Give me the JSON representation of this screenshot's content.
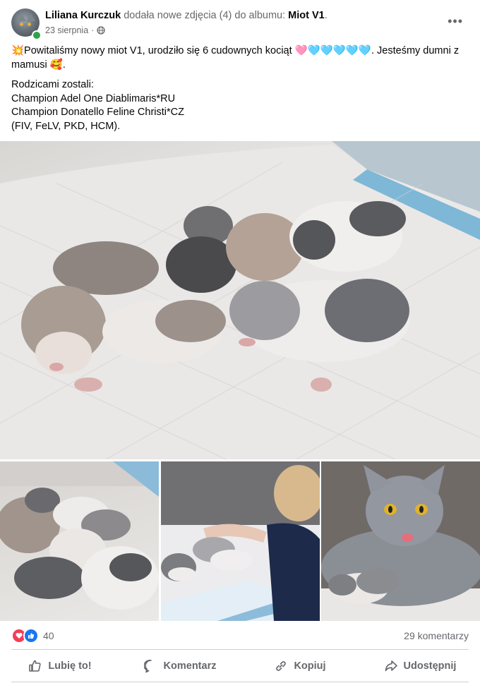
{
  "post": {
    "author": "Liliana Kurczuk",
    "action_text": "dodała nowe zdjęcia (4) do albumu:",
    "album": "Miot V1",
    "date": "23 sierpnia",
    "more_label": "•••",
    "text": {
      "line1": "💥Powitaliśmy nowy miot V1, urodziło się 6 cudownych kociąt 🩷🩵🩵🩵🩵🩵. Jesteśmy dumni z mamusi 🥰.",
      "line2": "Rodzicami zostali:",
      "line3": "Champion Adel One Diablimaris*RU",
      "line4": "Champion Donatello Feline Christi*CZ",
      "line5": "(FIV, FeLV, PKD, HCM)."
    },
    "reactions_count": "40",
    "comments_count": "29 komentarzy"
  },
  "actions": {
    "like": "Lubię to!",
    "comment": "Komentarz",
    "copy": "Kopiuj",
    "share": "Udostępnij"
  },
  "colors": {
    "secondary_text": "#65676b",
    "love": "#f33e58",
    "like": "#1877f2",
    "online": "#31a24c"
  }
}
